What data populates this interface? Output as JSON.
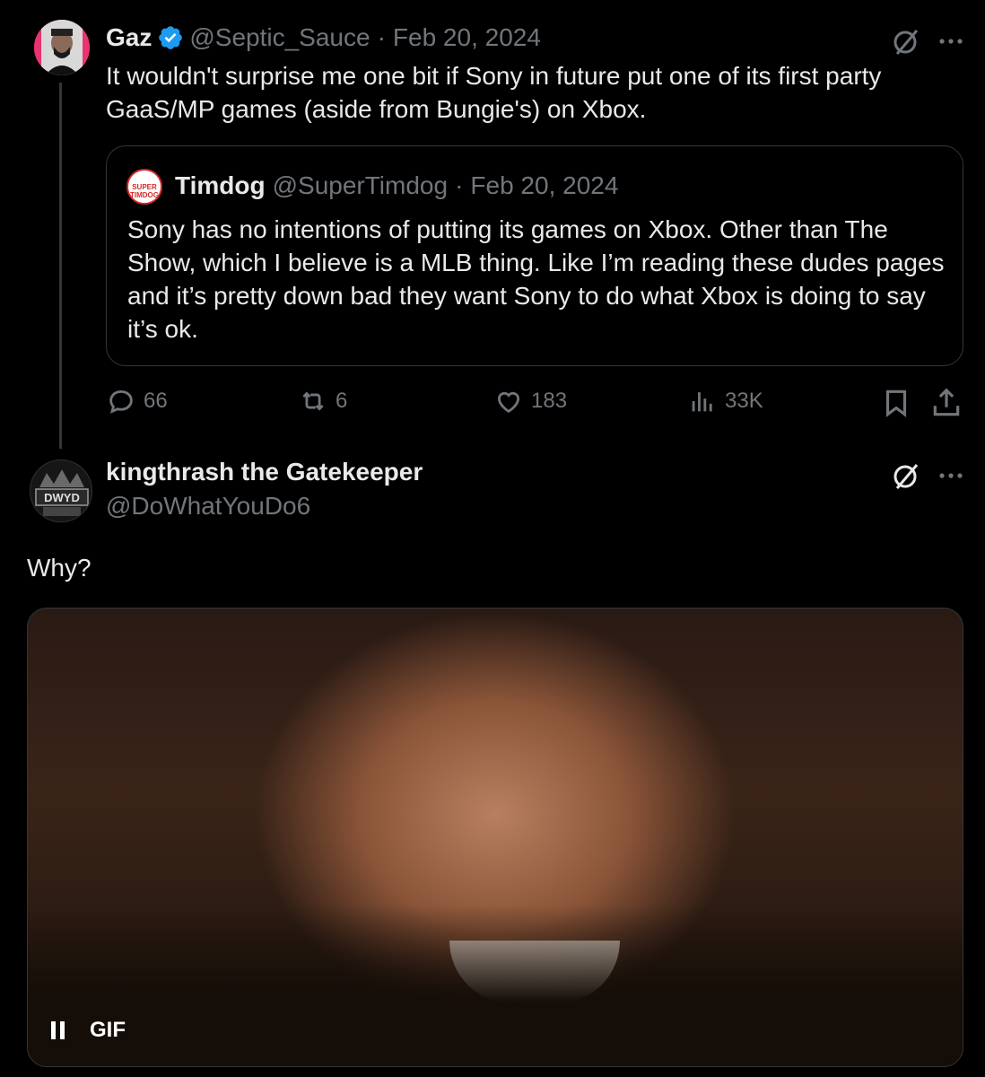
{
  "parent_tweet": {
    "author_name": "Gaz",
    "handle": "@Septic_Sauce",
    "separator": "·",
    "date": "Feb 20, 2024",
    "text": "It wouldn't surprise me one bit if Sony in future put one of its first party GaaS/MP games (aside from Bungie's) on Xbox.",
    "quote": {
      "author_name": "Timdog",
      "handle": "@SuperTimdog",
      "separator": "·",
      "date": "Feb 20, 2024",
      "avatar_text": "SUPER TIMDOG",
      "text": "Sony has no intentions of putting its games on Xbox.   Other than The Show, which I believe is a MLB thing.   Like I’m reading these dudes pages and it’s pretty down bad they want Sony to do what Xbox is doing to say it’s ok."
    },
    "actions": {
      "replies": "66",
      "reposts": "6",
      "likes": "183",
      "views": "33K"
    }
  },
  "reply_tweet": {
    "author_name": "kingthrash the Gatekeeper",
    "handle": "@DoWhatYouDo6",
    "avatar_text": "DWYD",
    "text": "Why?",
    "media": {
      "badge": "GIF"
    }
  },
  "icons": [
    "grok-icon",
    "more-icon",
    "reply-icon",
    "repost-icon",
    "like-icon",
    "views-icon",
    "bookmark-icon",
    "share-icon",
    "pause-icon",
    "verified-icon"
  ],
  "colors": {
    "background": "#000000",
    "text": "#e7e9ea",
    "muted": "#71767b",
    "border": "#333639",
    "verified": "#1d9bf0"
  }
}
